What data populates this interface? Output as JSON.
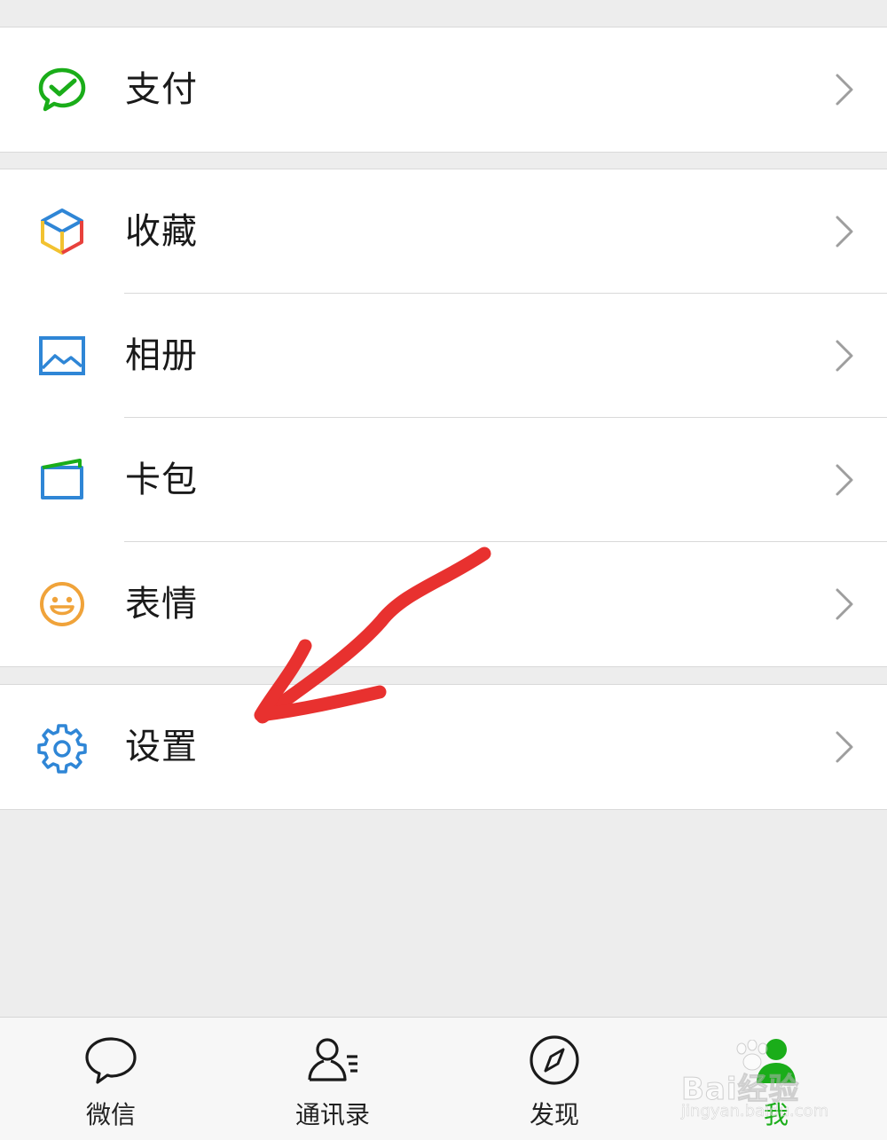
{
  "menu": {
    "pay": {
      "label": "支付",
      "icon": "wechat-pay-icon"
    },
    "favorites": {
      "label": "收藏",
      "icon": "cube-icon"
    },
    "album": {
      "label": "相册",
      "icon": "photo-icon"
    },
    "cards": {
      "label": "卡包",
      "icon": "card-wallet-icon"
    },
    "stickers": {
      "label": "表情",
      "icon": "smiley-icon"
    },
    "settings": {
      "label": "设置",
      "icon": "gear-icon"
    }
  },
  "tabbar": {
    "tabs": [
      {
        "label": "微信",
        "icon": "chat-bubble-icon",
        "active": false
      },
      {
        "label": "通讯录",
        "icon": "contacts-icon",
        "active": false
      },
      {
        "label": "发现",
        "icon": "compass-icon",
        "active": false
      },
      {
        "label": "我",
        "icon": "me-person-icon",
        "active": true
      }
    ]
  },
  "watermark": {
    "brand": "Bai经验",
    "url": "jingyan.baidu.com"
  },
  "colors": {
    "accent_green": "#1aad19",
    "background": "#ededed",
    "annotation_red": "#e8312f",
    "icon_blue": "#2f86d6",
    "icon_orange": "#f0a33a"
  }
}
